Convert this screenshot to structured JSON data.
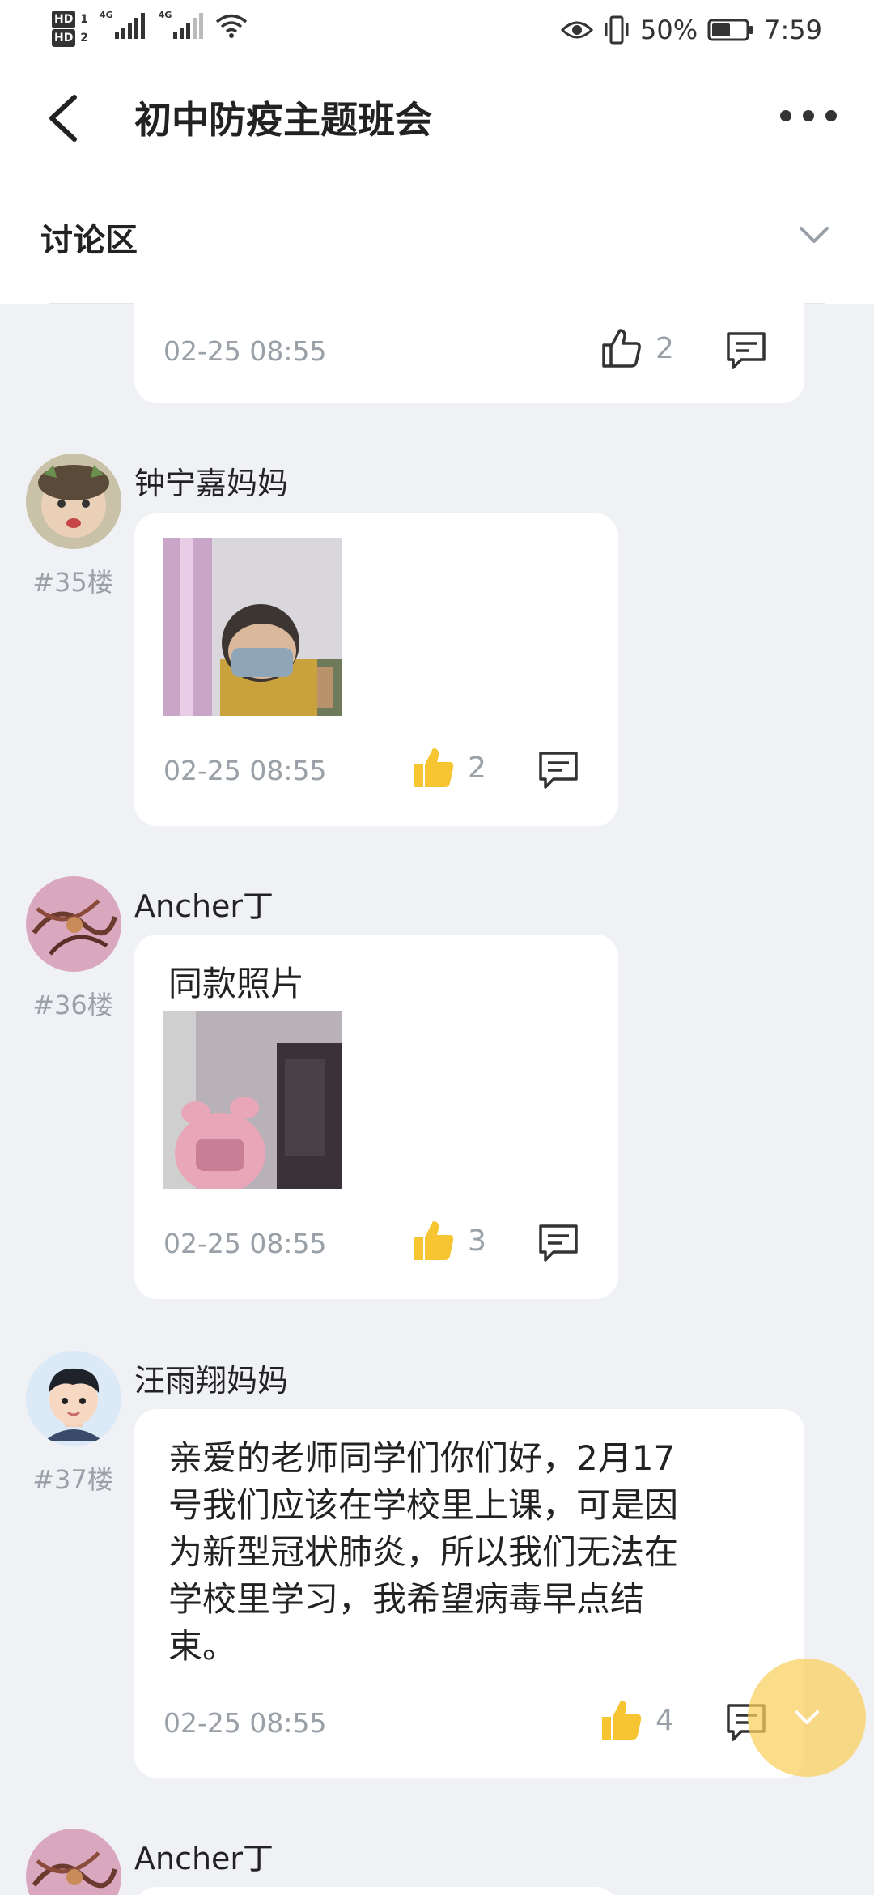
{
  "status_bar": {
    "hd1": "HD",
    "hd1_sub": "1",
    "hd2": "HD",
    "hd2_sub": "2",
    "net1": "4G",
    "net2": "4G",
    "battery_percent": "50%",
    "time": "7:59"
  },
  "header": {
    "title": "初中防疫主题班会"
  },
  "section": {
    "label": "讨论区"
  },
  "posts": [
    {
      "date": "02-25 08:55",
      "likes": "2",
      "liked": false
    },
    {
      "user": "钟宁嘉妈妈",
      "floor": "#35楼",
      "date": "02-25 08:55",
      "likes": "2",
      "liked": true
    },
    {
      "user": "Ancher丁",
      "floor": "#36楼",
      "text": "同款照片",
      "date": "02-25 08:55",
      "likes": "3",
      "liked": true
    },
    {
      "user": "汪雨翔妈妈",
      "floor": "#37楼",
      "text_lines": [
        "亲爱的老师同学们你们好，2月17",
        "号我们应该在学校里上课，可是因",
        "为新型冠状肺炎，所以我们无法在",
        "学校里学习，我希望病毒早点结",
        "束。"
      ],
      "date": "02-25 08:55",
      "likes": "4",
      "liked": true
    },
    {
      "user": "Ancher丁"
    }
  ],
  "colors": {
    "background": "#eff1f5",
    "like_active": "#f7c531",
    "muted_text": "#9aa0a8"
  },
  "icons": [
    "back-chevron-icon",
    "more-dots-icon",
    "chevron-down-icon",
    "thumbs-up-outline-icon",
    "thumbs-up-filled-icon",
    "comment-icon",
    "eye-icon",
    "vibrate-icon",
    "battery-icon",
    "wifi-icon"
  ]
}
